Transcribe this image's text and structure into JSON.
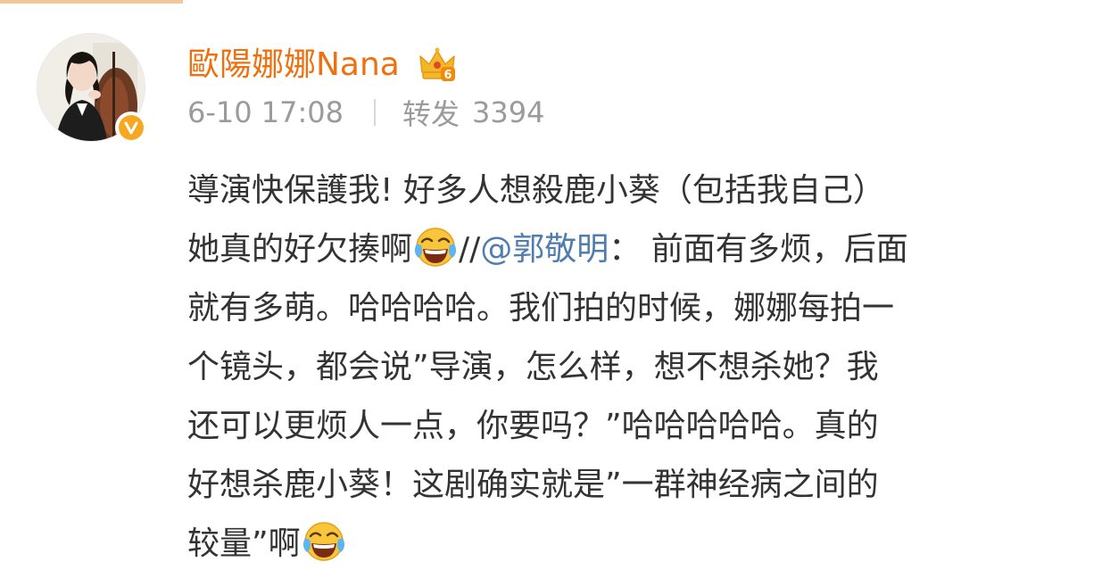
{
  "post": {
    "author": {
      "name": "歐陽娜娜Nana",
      "crown_badge_icon": "crown-level-6-icon",
      "verified_icon": "verified-v-icon"
    },
    "time": "6-10 17:08",
    "repost": {
      "label": "转发",
      "count": "3394"
    },
    "body": {
      "line1": "導演快保護我! 好多人想殺鹿小葵（包括我自己）",
      "line2_text": "她真的好欠揍啊",
      "line2_sep": "//",
      "line2_mention": "@郭敬明",
      "line2_rest": "：  前面有多烦，后面",
      "line3": "就有多萌。哈哈哈哈。我们拍的时候，娜娜每拍一",
      "line4": "个镜头，都会说”导演，怎么样，想不想杀她？我",
      "line5": "还可以更烦人一点，你要吗？”哈哈哈哈哈。真的",
      "line6": "好想杀鹿小葵！这剧确实就是”一群神经病之间的",
      "line7_text": "较量”啊",
      "emoji_name": "laugh-cry-emoji-icon"
    }
  },
  "colors": {
    "username": "#f0700f",
    "meta": "#9b9b9b",
    "body_text": "#333333",
    "mention": "#507daf",
    "verified_badge": "#f7a81e",
    "crown": "#f5b72a"
  }
}
